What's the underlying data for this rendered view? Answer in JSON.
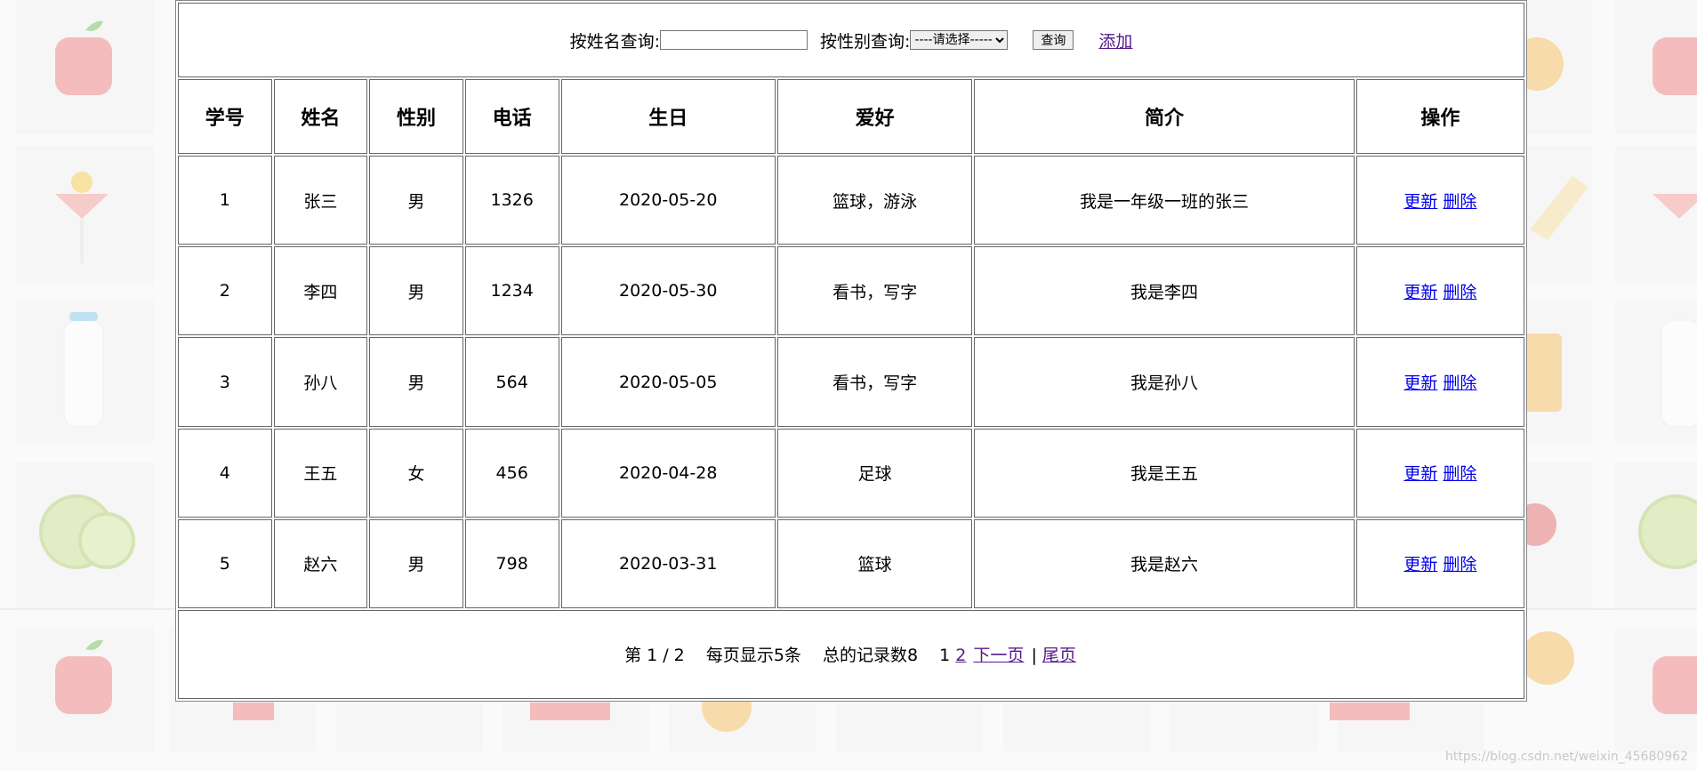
{
  "search": {
    "name_label": "按姓名查询:",
    "name_value": "",
    "gender_label": "按性别查询:",
    "gender_selected": "----请选择-----",
    "query_button": "查询",
    "add_link": "添加"
  },
  "table": {
    "headers": [
      "学号",
      "姓名",
      "性别",
      "电话",
      "生日",
      "爱好",
      "简介",
      "操作"
    ],
    "rows": [
      {
        "id": "1",
        "name": "张三",
        "gender": "男",
        "phone": "1326",
        "birthday": "2020-05-20",
        "hobby": "篮球，游泳",
        "intro": "我是一年级一班的张三"
      },
      {
        "id": "2",
        "name": "李四",
        "gender": "男",
        "phone": "1234",
        "birthday": "2020-05-30",
        "hobby": "看书，写字",
        "intro": "我是李四"
      },
      {
        "id": "3",
        "name": "孙八",
        "gender": "男",
        "phone": "564",
        "birthday": "2020-05-05",
        "hobby": "看书，写字",
        "intro": "我是孙八"
      },
      {
        "id": "4",
        "name": "王五",
        "gender": "女",
        "phone": "456",
        "birthday": "2020-04-28",
        "hobby": "足球",
        "intro": "我是王五"
      },
      {
        "id": "5",
        "name": "赵六",
        "gender": "男",
        "phone": "798",
        "birthday": "2020-03-31",
        "hobby": "篮球",
        "intro": "我是赵六"
      }
    ],
    "update_label": "更新",
    "delete_label": "删除"
  },
  "pager": {
    "page_info": "第 1 / 2",
    "page_size_info": "每页显示5条",
    "total_info": "总的记录数8",
    "current_page": "1",
    "page2_link": "2",
    "next_link": "下一页",
    "separator": "|",
    "last_link": "尾页"
  },
  "watermark": "https://blog.csdn.net/weixin_45680962",
  "colors": {
    "link": "#0000ee",
    "visited_link": "#551a8b",
    "border": "#666666"
  }
}
